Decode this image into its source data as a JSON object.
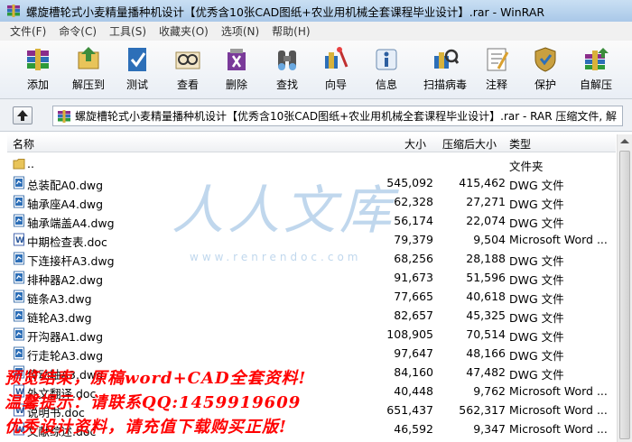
{
  "window": {
    "title": "螺旋槽轮式小麦精量播种机设计【优秀含10张CAD图纸+农业用机械全套课程毕业设计】.rar - WinRAR"
  },
  "menu": [
    "文件(F)",
    "命令(C)",
    "工具(S)",
    "收藏夹(O)",
    "选项(N)",
    "帮助(H)"
  ],
  "toolbar": [
    {
      "label": "添加",
      "icon": "add-archive-icon"
    },
    {
      "label": "解压到",
      "icon": "extract-to-icon"
    },
    {
      "label": "测试",
      "icon": "test-icon"
    },
    {
      "label": "查看",
      "icon": "view-icon"
    },
    {
      "label": "删除",
      "icon": "delete-icon"
    },
    {
      "label": "查找",
      "icon": "find-icon"
    },
    {
      "label": "向导",
      "icon": "wizard-icon"
    },
    {
      "label": "信息",
      "icon": "info-icon"
    },
    {
      "label": "扫描病毒",
      "icon": "virus-scan-icon"
    },
    {
      "label": "注释",
      "icon": "comment-icon"
    },
    {
      "label": "保护",
      "icon": "protect-icon"
    },
    {
      "label": "自解压",
      "icon": "sfx-icon"
    }
  ],
  "address": {
    "path": "螺旋槽轮式小麦精量播种机设计【优秀含10张CAD图纸+农业用机械全套课程毕业设计】.rar - RAR 压缩文件, 解"
  },
  "columns": {
    "name": "名称",
    "size": "大小",
    "packed": "压缩后大小",
    "type": "类型"
  },
  "files": [
    {
      "name": "..",
      "size": "",
      "packed": "",
      "type": "文件夹",
      "icon": "folder-icon"
    },
    {
      "name": "总装配A0.dwg",
      "size": "545,092",
      "packed": "415,462",
      "type": "DWG 文件",
      "icon": "dwg-file-icon"
    },
    {
      "name": "轴承座A4.dwg",
      "size": "62,328",
      "packed": "27,271",
      "type": "DWG 文件",
      "icon": "dwg-file-icon"
    },
    {
      "name": "轴承端盖A4.dwg",
      "size": "56,174",
      "packed": "22,074",
      "type": "DWG 文件",
      "icon": "dwg-file-icon"
    },
    {
      "name": "中期检查表.doc",
      "size": "79,379",
      "packed": "9,504",
      "type": "Microsoft Word ...",
      "icon": "word-file-icon"
    },
    {
      "name": "下连接杆A3.dwg",
      "size": "68,256",
      "packed": "28,188",
      "type": "DWG 文件",
      "icon": "dwg-file-icon"
    },
    {
      "name": "排种器A2.dwg",
      "size": "91,673",
      "packed": "51,596",
      "type": "DWG 文件",
      "icon": "dwg-file-icon"
    },
    {
      "name": "链条A3.dwg",
      "size": "77,665",
      "packed": "40,618",
      "type": "DWG 文件",
      "icon": "dwg-file-icon"
    },
    {
      "name": "链轮A3.dwg",
      "size": "82,657",
      "packed": "45,325",
      "type": "DWG 文件",
      "icon": "dwg-file-icon"
    },
    {
      "name": "开沟器A1.dwg",
      "size": "108,905",
      "packed": "70,514",
      "type": "DWG 文件",
      "icon": "dwg-file-icon"
    },
    {
      "name": "行走轮A3.dwg",
      "size": "97,647",
      "packed": "48,166",
      "type": "DWG 文件",
      "icon": "dwg-file-icon"
    },
    {
      "name": "传动轴A3.dwg",
      "size": "84,160",
      "packed": "47,482",
      "type": "DWG 文件",
      "icon": "dwg-file-icon"
    },
    {
      "name": "外文翻译.doc",
      "size": "40,448",
      "packed": "9,762",
      "type": "Microsoft Word ...",
      "icon": "word-file-icon"
    },
    {
      "name": "说明书.doc",
      "size": "651,437",
      "packed": "562,317",
      "type": "Microsoft Word ...",
      "icon": "word-file-icon"
    },
    {
      "name": "文献综述.doc",
      "size": "46,592",
      "packed": "9,347",
      "type": "Microsoft Word ...",
      "icon": "word-file-icon"
    }
  ],
  "watermark": {
    "text": "人人文库",
    "url": "www.renrendoc.com"
  },
  "overlay": [
    "预览结束，原稿word+CAD全套资料!",
    "温馨提示：请联系QQ:1459919609",
    "优秀设计资料，请充值下载购买正版!"
  ]
}
